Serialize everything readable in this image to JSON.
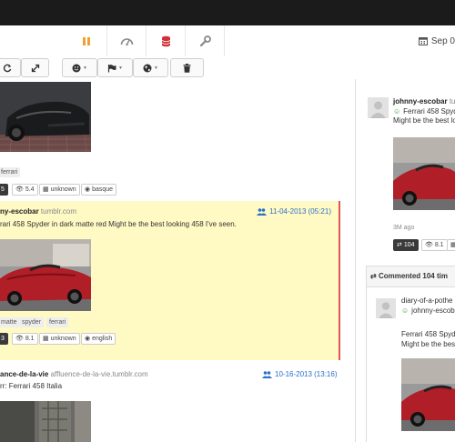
{
  "nav": {
    "date": "Sep 0"
  },
  "posts": [
    {
      "tags": [
        "ferrari"
      ],
      "stats": {
        "reblogs": "5",
        "views": "5.4",
        "source": "unknown",
        "language": "basque"
      }
    },
    {
      "author": "ny-escobar",
      "site": "tumblr.com",
      "date": "11-04-2013 (05:21)",
      "text": "rari 458 Spyder in dark matte red Might be the best looking 458 I've seen.",
      "tags": [
        "matte",
        "spyder",
        "ferrari"
      ],
      "stats": {
        "reblogs": "3",
        "views": "8.1",
        "source": "unknown",
        "language": "english"
      }
    },
    {
      "author": "ance-de-la-vie",
      "site": "affluence-de-la-vie.tumblr.com",
      "date": "10-16-2013 (13:16)",
      "text": "rr: Ferrari 458 Italia"
    }
  ],
  "detail": {
    "author": "johnny-escobar",
    "author_suffix": "tum",
    "line1": "Ferrari 458 Spyd",
    "line2": "Might be the best lo",
    "age": "3M ago",
    "reblogs": "104",
    "views": "8.1",
    "comments_header": "Commented 104 tim",
    "comment": {
      "author": "diary-of-a-pothe",
      "via": "johnny-escob",
      "line1": "Ferrari 458 Spyde",
      "line2": "Might be the bes"
    }
  }
}
